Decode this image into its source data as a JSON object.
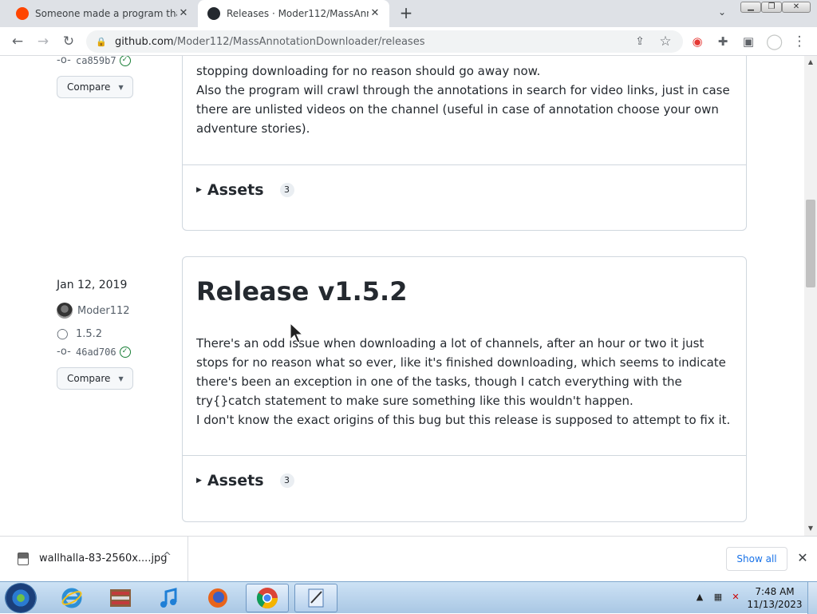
{
  "browser": {
    "tabs": [
      {
        "title": "Someone made a program that l",
        "close": "✕"
      },
      {
        "title": "Releases · Moder112/MassAnnot",
        "close": "✕"
      }
    ],
    "new_tab": "+",
    "tab_menu": "⌄",
    "window_controls": {
      "minimize": "▁",
      "restore": "❐",
      "close": "✕"
    },
    "nav": {
      "back": "←",
      "forward": "→",
      "reload": "↻"
    },
    "address": {
      "host": "github.com",
      "path": "/Moder112/MassAnnotationDownloader/releases"
    },
    "toolbar_icons": {
      "share": "⇪",
      "star": "☆",
      "extension_red": "◉",
      "puzzle": "✚",
      "sidepanel": "▣",
      "profile": "◯",
      "menu": "⋮"
    }
  },
  "releases": [
    {
      "sha": "ca859b7",
      "compare_label": "Compare",
      "body_lines": [
        "stopping downloading for no reason should go away now.",
        "Also the program will crawl through the annotations in search for video links, just in case there are unlisted videos on the channel (useful in case of annotation choose your own adventure stories)."
      ],
      "assets_label": "Assets",
      "assets_count": "3"
    },
    {
      "date": "Jan 12, 2019",
      "author": "Moder112",
      "tag": "1.5.2",
      "sha": "46ad706",
      "compare_label": "Compare",
      "title": "Release v1.5.2",
      "body_lines": [
        "There's an odd issue when downloading a lot of channels, after an hour or two it just stops for no reason what so ever, like it's finished downloading, which seems to indicate there's been an exception in one of the tasks, though I catch everything with the try{}catch statement to make sure something like this wouldn't happen.",
        "I don't know the exact origins of this bug but this release is supposed to attempt to fix it."
      ],
      "assets_label": "Assets",
      "assets_count": "3"
    }
  ],
  "downloads_bar": {
    "file_name": "wallhalla-83-2560x....jpg",
    "caret": "^",
    "show_all": "Show all",
    "close": "✕"
  },
  "taskbar": {
    "apps": [
      "internet-explorer",
      "file-manager",
      "itunes",
      "firefox",
      "chrome",
      "notepad"
    ],
    "clock_time": "7:48 AM",
    "clock_date": "11/13/2023"
  },
  "colors": {
    "link": "#1a73e8",
    "text": "#24292f",
    "muted": "#57606a",
    "verified": "#1a7f37",
    "border": "#d0d7de"
  }
}
